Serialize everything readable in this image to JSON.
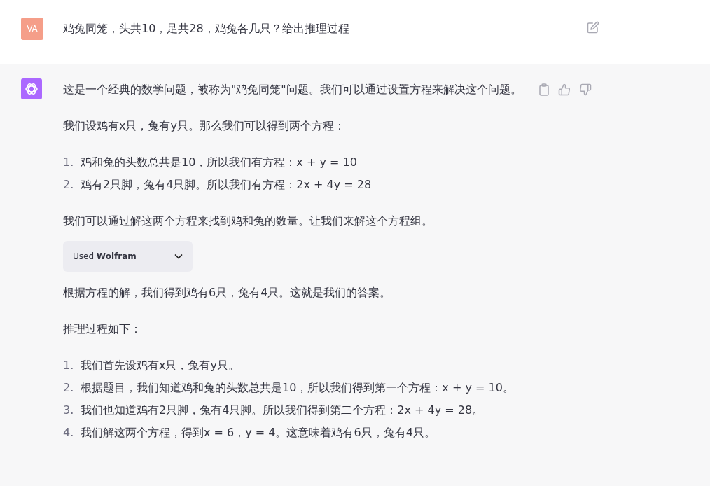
{
  "user_message": {
    "avatar": "VA",
    "text": "鸡兔同笼，头共10，足共28，鸡兔各几只？给出推理过程"
  },
  "assistant_message": {
    "blocks": [
      {
        "kind": "paragraph",
        "text": "这是一个经典的数学问题，被称为\"鸡兔同笼\"问题。我们可以通过设置方程来解决这个问题。"
      },
      {
        "kind": "paragraph",
        "text": "我们设鸡有x只，兔有y只。那么我们可以得到两个方程："
      },
      {
        "kind": "list",
        "items": [
          {
            "number": "1.",
            "text": "鸡和兔的头数总共是10，所以我们有方程：x + y = 10"
          },
          {
            "number": "2.",
            "text": "鸡有2只脚，兔有4只脚。所以我们有方程：2x + 4y = 28"
          }
        ]
      },
      {
        "kind": "paragraph",
        "text": "我们可以通过解这两个方程来找到鸡和兔的数量。让我们来解这个方程组。"
      },
      {
        "kind": "tool",
        "text": "Used **Wolfram**"
      },
      {
        "kind": "paragraph",
        "text": "根据方程的解，我们得到鸡有6只，兔有4只。这就是我们的答案。"
      },
      {
        "kind": "paragraph",
        "text": "推理过程如下："
      },
      {
        "kind": "list",
        "items": [
          {
            "number": "1.",
            "text": "我们首先设鸡有x只，兔有y只。"
          },
          {
            "number": "2.",
            "text": "根据题目，我们知道鸡和兔的头数总共是10，所以我们得到第一个方程：x + y = 10。"
          },
          {
            "number": "3.",
            "text": "我们也知道鸡有2只脚，兔有4只脚。所以我们得到第二个方程：2x + 4y = 28。"
          },
          {
            "number": "4.",
            "text": "我们解这两个方程，得到x = 6，y = 4。这意味着鸡有6只，兔有4只。"
          }
        ]
      }
    ]
  }
}
